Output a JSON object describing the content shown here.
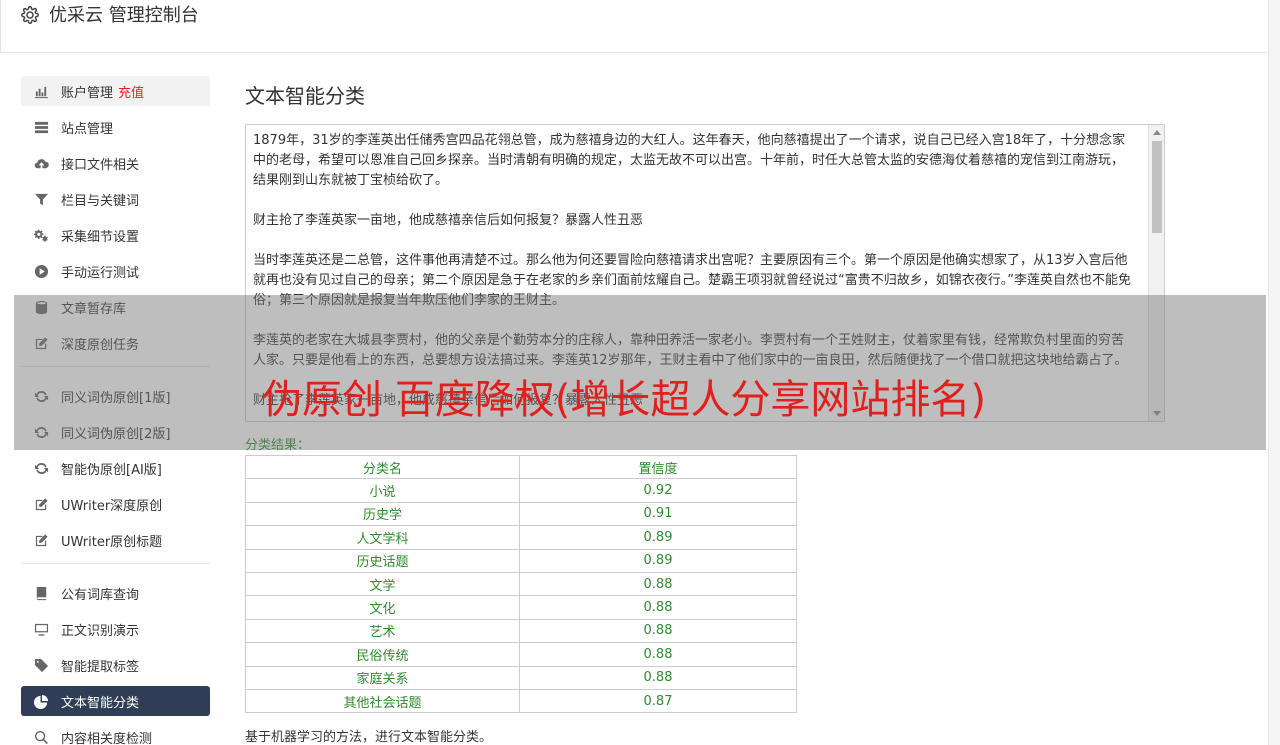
{
  "header": {
    "title": "优采云 管理控制台"
  },
  "sidebar": {
    "group1": [
      {
        "label": "账户管理",
        "badge": "充值",
        "icon": "bar-chart-icon",
        "state": "light"
      },
      {
        "label": "站点管理",
        "icon": "server-icon"
      },
      {
        "label": "接口文件相关",
        "icon": "cloud-upload-icon"
      },
      {
        "label": "栏目与关键词",
        "icon": "filter-icon"
      },
      {
        "label": "采集细节设置",
        "icon": "gears-icon"
      },
      {
        "label": "手动运行测试",
        "icon": "play-circle-icon"
      },
      {
        "label": "文章暂存库",
        "icon": "database-icon"
      },
      {
        "label": "深度原创任务",
        "icon": "edit-icon"
      }
    ],
    "group2": [
      {
        "label": "同义词伪原创[1版]",
        "icon": "refresh-icon"
      },
      {
        "label": "同义词伪原创[2版]",
        "icon": "refresh-icon"
      },
      {
        "label": "智能伪原创[AI版]",
        "icon": "refresh-icon"
      },
      {
        "label": "UWriter深度原创",
        "icon": "edit-icon"
      },
      {
        "label": "UWriter原创标题",
        "icon": "edit-icon"
      }
    ],
    "group3": [
      {
        "label": "公有词库查询",
        "icon": "book-icon"
      },
      {
        "label": "正文识别演示",
        "icon": "monitor-icon"
      },
      {
        "label": "智能提取标签",
        "icon": "tag-icon"
      },
      {
        "label": "文本智能分类",
        "icon": "pie-chart-icon",
        "state": "dark"
      },
      {
        "label": "内容相关度检测",
        "icon": "search-icon"
      }
    ]
  },
  "main": {
    "title": "文本智能分类",
    "paragraphs": [
      "1879年，31岁的李莲英出任储秀宫四品花翎总管，成为慈禧身边的大红人。这年春天，他向慈禧提出了一个请求，说自己已经入宫18年了，十分想念家中的老母，希望可以恩准自己回乡探亲。当时清朝有明确的规定，太监无故不可以出宫。十年前，时任大总管太监的安德海仗着慈禧的宠信到江南游玩，结果刚到山东就被丁宝桢给砍了。",
      "财主抢了李莲英家一亩地，他成慈禧亲信后如何报复？暴露人性丑恶",
      "当时李莲英还是二总管，这件事他再清楚不过。那么他为何还要冒险向慈禧请求出宫呢？主要原因有三个。第一个原因是他确实想家了，从13岁入宫后他就再也没有见过自己的母亲；第二个原因是急于在老家的乡亲们面前炫耀自己。楚霸王项羽就曾经说过“富贵不归故乡，如锦衣夜行。”李莲英自然也不能免俗；第三个原因就是报复当年欺压他们李家的王财主。",
      "李莲英的老家在大城县李贾村，他的父亲是个勤劳本分的庄稼人，靠种田养活一家老小。李贾村有一个王姓财主，仗着家里有钱，经常欺负村里面的穷苦人家。只要是他看上的东西，总要想方设法搞过来。李莲英12岁那年，王财主看中了他们家中的一亩良田，然后随便找了一个借口就把这块地给霸占了。",
      "财主抢了李莲英家一亩地，他成慈禧亲信后如何报复？暴露人性丑恶"
    ],
    "result_label": "分类结果：",
    "table": {
      "headers": [
        "分类名",
        "置信度"
      ],
      "rows": [
        [
          "小说",
          "0.92"
        ],
        [
          "历史学",
          "0.91"
        ],
        [
          "人文学科",
          "0.89"
        ],
        [
          "历史话题",
          "0.89"
        ],
        [
          "文学",
          "0.88"
        ],
        [
          "文化",
          "0.88"
        ],
        [
          "艺术",
          "0.88"
        ],
        [
          "民俗传统",
          "0.88"
        ],
        [
          "家庭关系",
          "0.88"
        ],
        [
          "其他社会话题",
          "0.87"
        ]
      ]
    },
    "footnote": "基于机器学习的方法，进行文本智能分类。"
  },
  "watermark": "伪原创 百度降权(增长超人分享网站排名)",
  "colors": {
    "active_dark": "#2f3e56",
    "result_green": "#2e8b2e",
    "recharge_red": "#e52525",
    "watermark_red": "#e1201e"
  }
}
